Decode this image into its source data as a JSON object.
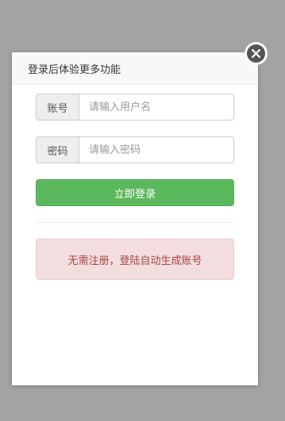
{
  "modal": {
    "title": "登录后体验更多功能"
  },
  "form": {
    "account_label": "账号",
    "account_placeholder": "请输入用户名",
    "account_value": "",
    "password_label": "密码",
    "password_placeholder": "请输入密码",
    "password_value": "",
    "submit_label": "立即登录"
  },
  "notice": {
    "text": "无需注册，登陆自动生成账号"
  },
  "icons": {
    "close": "close-icon"
  },
  "colors": {
    "overlay": "#a3a3a3",
    "primary_button": "#5cb85c",
    "alert_bg": "#f2dede",
    "alert_text": "#a94442",
    "close_circle": "#555555"
  }
}
